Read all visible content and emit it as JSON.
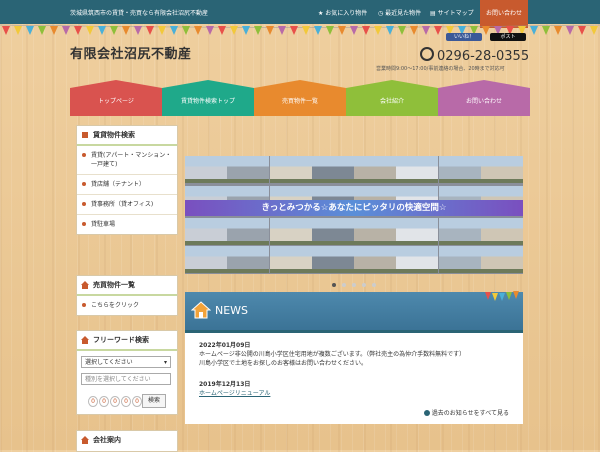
{
  "topbar": {
    "tagline": "茨城県筑西市の賃貸・売買なら有限会社沼尻不動産",
    "favorites": "お気に入り物件",
    "recent": "最近見た物件",
    "sitemap": "サイトマップ",
    "contact": "お問い合わせ"
  },
  "header": {
    "logo": "有限会社沼尻不動産",
    "like": "いいね！",
    "post": "ポスト",
    "phone": "0296-28-0355",
    "hours": "営業時間9:00～17:00/事前連絡の場合、20時まで対応可"
  },
  "nav": {
    "tabs": [
      {
        "label": "トップページ",
        "color": "#d9534f"
      },
      {
        "label": "賃貸物件検索トップ",
        "color": "#1fa98a"
      },
      {
        "label": "売買物件一覧",
        "color": "#e88a2e"
      },
      {
        "label": "会社紹介",
        "color": "#8fbf3a"
      },
      {
        "label": "お問い合わせ",
        "color": "#b86aa8"
      }
    ]
  },
  "sidebar": {
    "rental_title": "賃貸物件検索",
    "rental_items": [
      {
        "label": "賃貸(アパート・マンション・一戸建て)"
      },
      {
        "label": "貸店舗（テナント）"
      },
      {
        "label": "貸事務所（貸オフィス)"
      },
      {
        "label": "貸駐車場"
      }
    ],
    "sale_title": "売買物件一覧",
    "sale_link": "こちらをクリック",
    "keyword_title": "フリーワード検索",
    "select_placeholder": "選択してください",
    "type_placeholder": "種別を選択してください",
    "counter_digits": [
      "0",
      "0",
      "0",
      "0",
      "0"
    ],
    "counter_unit": "件",
    "search_button": "検索",
    "company_title": "会社案内"
  },
  "slider": {
    "banner": "きっとみつかる☆あなたにピッタリの快適空間☆"
  },
  "news": {
    "title": "NEWS",
    "entries": [
      {
        "date": "2022年01月09日",
        "line1": "ホームページ非公開の川島小学区住宅用地が複数ございます。（弊社売主の為仲介手数料無料です）",
        "line2": "川島小学区で土地をお探しのお客様はお問い合わせください。"
      },
      {
        "date": "2019年12月13日",
        "link": "ホームページリニューアル"
      }
    ],
    "more": "過去のお知らせをすべて見る"
  },
  "colors": {
    "topbar": "#2a6475",
    "accent": "#c85a2e"
  }
}
